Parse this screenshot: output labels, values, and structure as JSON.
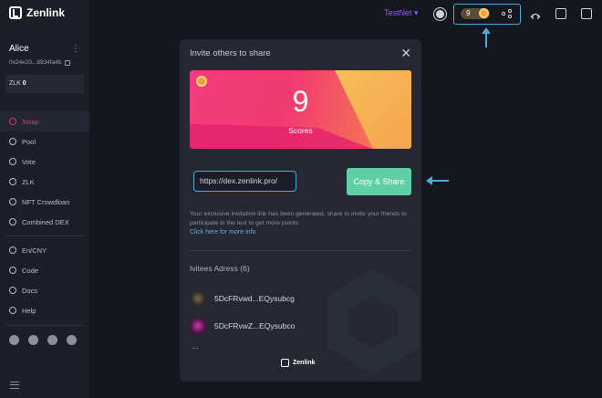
{
  "app": {
    "logo_text": "Zenlink"
  },
  "account": {
    "name": "Alice",
    "address": "0x24e20...8934fa4b",
    "zlk_label": "ZLK",
    "zlk_value": "0"
  },
  "nav": {
    "main": [
      "Swap",
      "Pool",
      "Vote",
      "ZLK",
      "NFT Crowdloan",
      "Combined DEX"
    ],
    "secondary": [
      "En/CNY",
      "Code",
      "Docs",
      "Help"
    ]
  },
  "topbar": {
    "network": "TestNet",
    "score": "9"
  },
  "modal": {
    "title": "Invite others to share",
    "score": "9",
    "score_label": "Scores",
    "link": "https://dex.zenlink.pro/",
    "button": "Copy & Share",
    "info": "Your exclusive invitation link has been generated, share to invite your friends to participate in the test to get more points.",
    "info_link": "Click here for more info",
    "invitees_label": "Ivitees Adress",
    "invitees_count": "(6)",
    "invitees": [
      "5DcFRvwd...EQysubcg",
      "5DcFRvwZ...EQysubco"
    ],
    "more": "...",
    "footer_logo": "Zenlink"
  },
  "colors": {
    "accent": "#e8336d",
    "highlight": "#4aa9d8",
    "button": "#5fd0a5",
    "network": "#8e5cf0"
  },
  "icons": [
    "zenlink-logo-icon",
    "sun-icon",
    "medal-icon",
    "share-icon",
    "bridge-icon",
    "wallet-icon",
    "settings-icon",
    "close-icon"
  ]
}
